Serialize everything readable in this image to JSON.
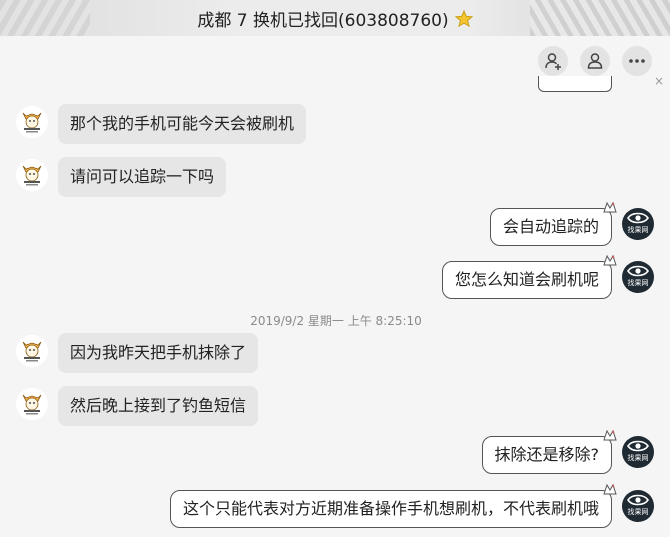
{
  "window": {
    "title": "成都 7 换机已找回(603808760)"
  },
  "toolbar": {
    "add_member_icon": "add-person-icon",
    "member_icon": "person-icon",
    "more_icon": "more-icon"
  },
  "close_label": "×",
  "messages": [
    {
      "side": "in",
      "text": "那个我的手机可能今天会被刷机"
    },
    {
      "side": "in",
      "text": "请问可以追踪一下吗"
    },
    {
      "side": "out",
      "text": "会自动追踪的"
    },
    {
      "side": "out",
      "text": "您怎么知道会刷机呢"
    },
    {
      "side": "in",
      "text": "因为我昨天把手机抹除了"
    },
    {
      "side": "in",
      "text": "然后晚上接到了钓鱼短信"
    },
    {
      "side": "out",
      "text": "抹除还是移除?"
    },
    {
      "side": "out",
      "text": "这个只能代表对方近期准备操作手机想刷机，不代表刷机哦"
    }
  ],
  "timestamp": "2019/9/2 星期一 上午 8:25:10",
  "agent_avatar_label": "找果网",
  "colors": {
    "bubble_in": "#e6e6e6",
    "bubble_out": "#ffffff",
    "agent_avatar": "#1f2a33"
  }
}
